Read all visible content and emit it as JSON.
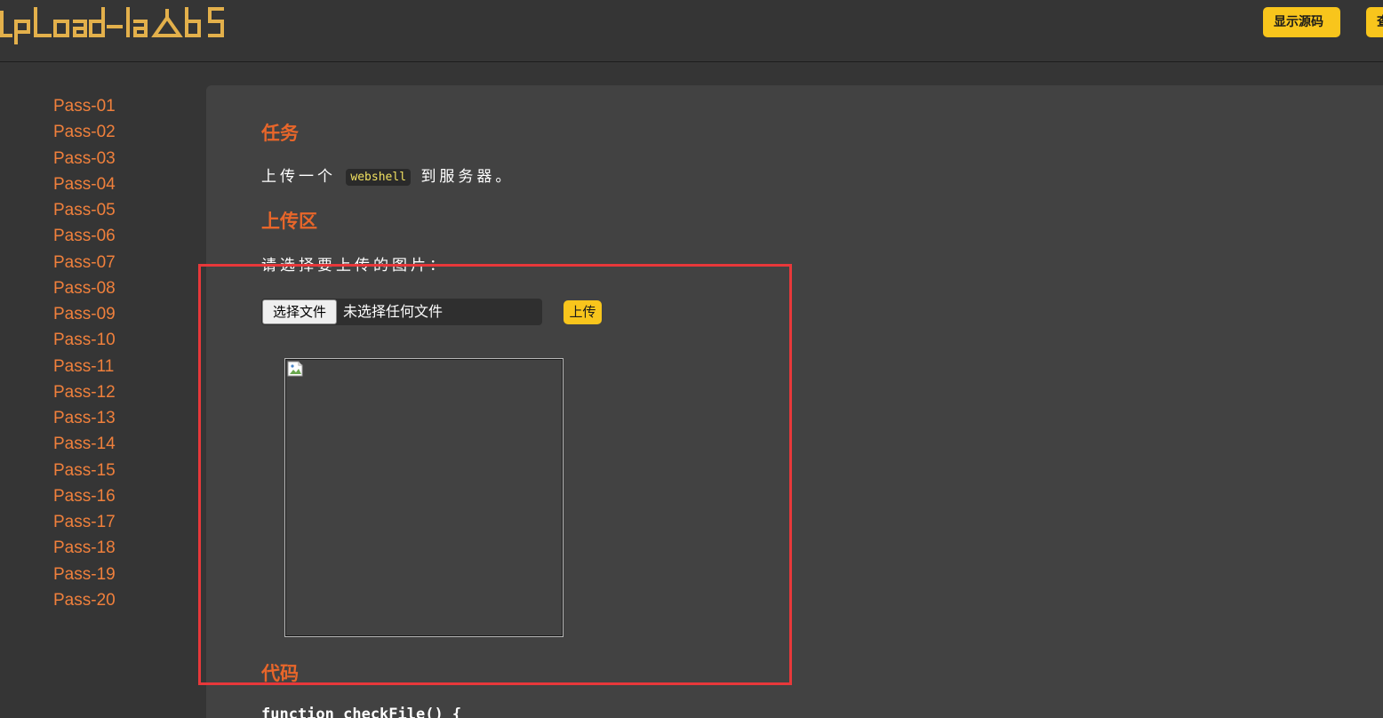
{
  "header": {
    "logo_text": "Upload-labs",
    "buttons": [
      {
        "label": "显示源码"
      },
      {
        "label": "查看提示"
      }
    ]
  },
  "sidebar": {
    "items": [
      {
        "label": "Pass-01"
      },
      {
        "label": "Pass-02"
      },
      {
        "label": "Pass-03"
      },
      {
        "label": "Pass-04"
      },
      {
        "label": "Pass-05"
      },
      {
        "label": "Pass-06"
      },
      {
        "label": "Pass-07"
      },
      {
        "label": "Pass-08"
      },
      {
        "label": "Pass-09"
      },
      {
        "label": "Pass-10"
      },
      {
        "label": "Pass-11"
      },
      {
        "label": "Pass-12"
      },
      {
        "label": "Pass-13"
      },
      {
        "label": "Pass-14"
      },
      {
        "label": "Pass-15"
      },
      {
        "label": "Pass-16"
      },
      {
        "label": "Pass-17"
      },
      {
        "label": "Pass-18"
      },
      {
        "label": "Pass-19"
      },
      {
        "label": "Pass-20"
      }
    ]
  },
  "task": {
    "title": "任务",
    "text_before": "上传一个",
    "code": "webshell",
    "text_after": "到服务器。"
  },
  "upload_area": {
    "title": "上传区",
    "prompt": "请选择要上传的图片：",
    "file_button": "选择文件",
    "file_status": "未选择任何文件",
    "submit_label": "上传"
  },
  "code_section": {
    "title": "代码",
    "first_line": "function checkFile() {"
  },
  "colors": {
    "accent_yellow": "#f8c51c",
    "heading_orange": "#e8662a",
    "link_orange": "#f0803c",
    "highlight_red": "#e8383a"
  }
}
